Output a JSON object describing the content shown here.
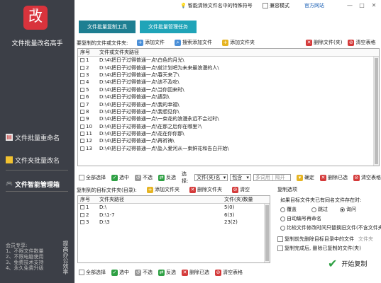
{
  "sidebar": {
    "logo_main": "改",
    "logo_sub": "批量",
    "app_title": "文件批量改名高手",
    "items": [
      {
        "label": "文件批量重命名",
        "icon": "document-icon"
      },
      {
        "label": "文件夹批量改名",
        "icon": "folder-icon"
      },
      {
        "label": "文件智能管理箱",
        "icon": "gamepad-icon",
        "active": true
      }
    ],
    "footer_lines": [
      "会员专享:",
      "1、不限文件数量",
      "2、不限电脑使用",
      "3、免费技术支持",
      "4、永久免费升级"
    ],
    "footer_vertical": "提高办公效率"
  },
  "topbar": {
    "hint": "智能清除文件名中的特殊符号",
    "compat_label": "兼容模式",
    "site_link": "官方网站",
    "min": "—",
    "max": "□",
    "close": "✕"
  },
  "tabs": [
    "文件批量复制工具",
    "文件批量管理任务"
  ],
  "source": {
    "label": "要复制的文件或文件夹:",
    "toolbar": [
      {
        "label": "添加文件",
        "icon": "add-file-icon",
        "color": "#4a8fd8"
      },
      {
        "label": "搜索添加文件",
        "icon": "search-add-icon",
        "color": "#4a8fd8"
      },
      {
        "label": "添加文件夹",
        "icon": "add-folder-icon",
        "color": "#e6b422"
      },
      {
        "label": "删除文件(夹)",
        "icon": "delete-icon",
        "color": "#d43a3a"
      },
      {
        "label": "清空表格",
        "icon": "clear-icon",
        "color": "#d43a3a"
      }
    ],
    "headers": [
      "序号",
      "文件或文件夹路径"
    ],
    "rows": [
      {
        "no": "1",
        "path": "D:\\4\\把日子过得普通一点\\白色的月光\\"
      },
      {
        "no": "2",
        "path": "D:\\4\\把日子过得普通一点\\就计划吧为未来最浪漫的人\\"
      },
      {
        "no": "3",
        "path": "D:\\4\\把日子过得普通一点\\春天来了\\"
      },
      {
        "no": "4",
        "path": "D:\\4\\把日子过得普通一点\\该不及吃\\"
      },
      {
        "no": "5",
        "path": "D:\\4\\把日子过得普通一点\\当你回来时\\"
      },
      {
        "no": "6",
        "path": "D:\\4\\把日子过得普通一点\\遇到\\"
      },
      {
        "no": "7",
        "path": "D:\\4\\把日子过得普通一点\\我的幸福\\"
      },
      {
        "no": "8",
        "path": "D:\\4\\把日子过得普通一点\\我想见你\\"
      },
      {
        "no": "9",
        "path": "D:\\4\\把日子过得普通一点\\一束花的浪漫永远不会过时\\"
      },
      {
        "no": "10",
        "path": "D:\\4\\把日子过得普通一点\\在那之后你在哪里?\\"
      },
      {
        "no": "11",
        "path": "D:\\4\\把日子过得普通一点\\花在你你那\\"
      },
      {
        "no": "12",
        "path": "D:\\4\\把日子过得普通一点\\再祈祷\\"
      },
      {
        "no": "13",
        "path": "D:\\4\\把日子过得普通一点\\坠入爱河从一束鲜花和告白开始\\"
      }
    ],
    "bottom": {
      "select_all": "全部选择",
      "select": "选中",
      "unselect": "不选",
      "invert": "反选",
      "choose_label": "选择:",
      "choose_value": "文件(夹)名",
      "match_value": "包含",
      "keyword_placeholder": "多词用 | 隔开",
      "confirm": "确定",
      "delete_selected": "删除已选",
      "clear": "清空表格"
    }
  },
  "target": {
    "label": "复制到的目标文件夹(目录):",
    "toolbar": [
      {
        "label": "添加文件夹",
        "icon": "add-folder-icon",
        "color": "#e6b422"
      },
      {
        "label": "删除文件夹",
        "icon": "delete-icon",
        "color": "#d43a3a"
      },
      {
        "label": "清空",
        "icon": "clear-icon",
        "color": "#d43a3a"
      }
    ],
    "headers": [
      "序号",
      "文件夹路径",
      "文件(夹)数量"
    ],
    "rows": [
      {
        "no": "1",
        "path": "D:\\",
        "count": "5(0)"
      },
      {
        "no": "2",
        "path": "D:\\1-7",
        "count": "6(3)"
      },
      {
        "no": "3",
        "path": "D:\\3",
        "count": "23(2)"
      }
    ],
    "bottom": {
      "select_all": "全部选择",
      "select": "选中",
      "unselect": "不选",
      "invert": "反选",
      "delete_selected": "删除已选",
      "clear": "清空表格"
    }
  },
  "options": {
    "title": "复制选项",
    "conflict_label": "如果目标文件夹已有同名文件存在时:",
    "radios": [
      {
        "label": "覆盖",
        "on": false
      },
      {
        "label": "跳过",
        "on": false
      },
      {
        "label": "询问",
        "on": true
      }
    ],
    "auto_rename": "自动编号再命名",
    "replace_older": "比较文件修改时间只替换旧文件(不含文件夹)",
    "delete_target": "复制前先删除目标目录中的文件",
    "delete_target_suffix": "文件夹",
    "delete_source": "复制完成后, 删除已复制的文件(夹)",
    "start": "开始复制"
  }
}
